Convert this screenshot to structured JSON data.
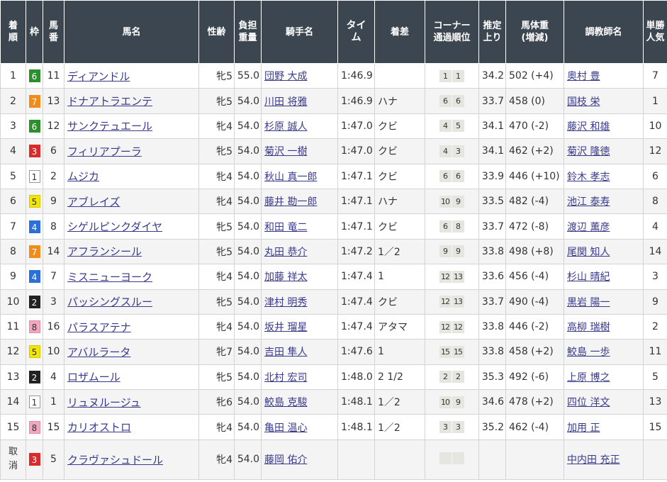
{
  "headers": {
    "rank": "着順",
    "waku": "枠",
    "umaban": "馬番",
    "horse": "馬名",
    "sexage": "性齢",
    "weight": "負担重量",
    "jockey": "騎手名",
    "time": "タイム",
    "margin": "着差",
    "corner": "コーナー通過順位",
    "last3f": "推定上り",
    "bodyweight": "馬体重(増減)",
    "trainer": "調教師名",
    "pop": "単勝人気"
  },
  "rows": [
    {
      "rank": "1",
      "waku": "6",
      "umaban": "11",
      "horse": "ディアンドル",
      "sexage": "牝5",
      "weight": "55.0",
      "jockey": "団野 大成",
      "time": "1:46.9",
      "margin": "",
      "corner": [
        "1",
        "1"
      ],
      "last3f": "34.2",
      "bodyweight": "502 (+4)",
      "trainer": "奥村 豊",
      "pop": "7"
    },
    {
      "rank": "2",
      "waku": "7",
      "umaban": "13",
      "horse": "ドナアトラエンテ",
      "sexage": "牝5",
      "weight": "54.0",
      "jockey": "川田 将雅",
      "time": "1:46.9",
      "margin": "ハナ",
      "corner": [
        "6",
        "6"
      ],
      "last3f": "33.7",
      "bodyweight": "458 (0)",
      "trainer": "国枝 栄",
      "pop": "1"
    },
    {
      "rank": "3",
      "waku": "6",
      "umaban": "12",
      "horse": "サンクテュエール",
      "sexage": "牝4",
      "weight": "54.0",
      "jockey": "杉原 誠人",
      "time": "1:47.0",
      "margin": "クビ",
      "corner": [
        "4",
        "5"
      ],
      "last3f": "34.1",
      "bodyweight": "470 (-2)",
      "trainer": "藤沢 和雄",
      "pop": "10"
    },
    {
      "rank": "4",
      "waku": "3",
      "umaban": "6",
      "horse": "フィリアプーラ",
      "sexage": "牝5",
      "weight": "54.0",
      "jockey": "菊沢 一樹",
      "time": "1:47.0",
      "margin": "クビ",
      "corner": [
        "4",
        "3"
      ],
      "last3f": "34.1",
      "bodyweight": "462 (+2)",
      "trainer": "菊沢 隆徳",
      "pop": "12"
    },
    {
      "rank": "5",
      "waku": "1",
      "umaban": "2",
      "horse": "ムジカ",
      "sexage": "牝4",
      "weight": "54.0",
      "jockey": "秋山 真一郎",
      "time": "1:47.1",
      "margin": "クビ",
      "corner": [
        "6",
        "6"
      ],
      "last3f": "33.9",
      "bodyweight": "446 (+10)",
      "trainer": "鈴木 孝志",
      "pop": "6"
    },
    {
      "rank": "6",
      "waku": "5",
      "umaban": "9",
      "horse": "アブレイズ",
      "sexage": "牝4",
      "weight": "54.0",
      "jockey": "藤井 勘一郎",
      "time": "1:47.1",
      "margin": "ハナ",
      "corner": [
        "10",
        "9"
      ],
      "last3f": "33.5",
      "bodyweight": "482 (-4)",
      "trainer": "池江 泰寿",
      "pop": "8"
    },
    {
      "rank": "7",
      "waku": "4",
      "umaban": "8",
      "horse": "シゲルピンクダイヤ",
      "sexage": "牝5",
      "weight": "54.0",
      "jockey": "和田 竜二",
      "time": "1:47.1",
      "margin": "クビ",
      "corner": [
        "6",
        "8"
      ],
      "last3f": "33.7",
      "bodyweight": "472 (-8)",
      "trainer": "渡辺 薫彦",
      "pop": "4"
    },
    {
      "rank": "8",
      "waku": "7",
      "umaban": "14",
      "horse": "アフランシール",
      "sexage": "牝5",
      "weight": "54.0",
      "jockey": "丸田 恭介",
      "time": "1:47.2",
      "margin": "1／2",
      "corner": [
        "9",
        "9"
      ],
      "last3f": "33.8",
      "bodyweight": "498 (+8)",
      "trainer": "尾関 知人",
      "pop": "14"
    },
    {
      "rank": "9",
      "waku": "4",
      "umaban": "7",
      "horse": "ミスニューヨーク",
      "sexage": "牝4",
      "weight": "54.0",
      "jockey": "加藤 祥太",
      "time": "1:47.4",
      "margin": "1",
      "corner": [
        "12",
        "13"
      ],
      "last3f": "33.6",
      "bodyweight": "456 (-4)",
      "trainer": "杉山 晴紀",
      "pop": "3"
    },
    {
      "rank": "10",
      "waku": "2",
      "umaban": "3",
      "horse": "パッシングスルー",
      "sexage": "牝5",
      "weight": "54.0",
      "jockey": "津村 明秀",
      "time": "1:47.4",
      "margin": "クビ",
      "corner": [
        "12",
        "13"
      ],
      "last3f": "33.7",
      "bodyweight": "490 (-4)",
      "trainer": "黒岩 陽一",
      "pop": "9"
    },
    {
      "rank": "11",
      "waku": "8",
      "umaban": "16",
      "horse": "パラスアテナ",
      "sexage": "牝4",
      "weight": "54.0",
      "jockey": "坂井 瑠星",
      "time": "1:47.4",
      "margin": "アタマ",
      "corner": [
        "12",
        "12"
      ],
      "last3f": "33.8",
      "bodyweight": "446 (-2)",
      "trainer": "高柳 瑞樹",
      "pop": "2"
    },
    {
      "rank": "12",
      "waku": "5",
      "umaban": "10",
      "horse": "アバルラータ",
      "sexage": "牝7",
      "weight": "54.0",
      "jockey": "吉田 隼人",
      "time": "1:47.6",
      "margin": "1",
      "corner": [
        "15",
        "15"
      ],
      "last3f": "33.8",
      "bodyweight": "458 (+2)",
      "trainer": "鮫島 一歩",
      "pop": "11"
    },
    {
      "rank": "13",
      "waku": "2",
      "umaban": "4",
      "horse": "ロザムール",
      "sexage": "牝5",
      "weight": "54.0",
      "jockey": "北村 宏司",
      "time": "1:48.0",
      "margin": "2 1/2",
      "corner": [
        "2",
        "2"
      ],
      "last3f": "35.3",
      "bodyweight": "492 (-6)",
      "trainer": "上原 博之",
      "pop": "5"
    },
    {
      "rank": "14",
      "waku": "1",
      "umaban": "1",
      "horse": "リュヌルージュ",
      "sexage": "牝6",
      "weight": "54.0",
      "jockey": "鮫島 克駿",
      "time": "1:48.1",
      "margin": "1／2",
      "corner": [
        "10",
        "9"
      ],
      "last3f": "34.6",
      "bodyweight": "478 (+2)",
      "trainer": "四位 洋文",
      "pop": "13"
    },
    {
      "rank": "15",
      "waku": "8",
      "umaban": "15",
      "horse": "カリオストロ",
      "sexage": "牝4",
      "weight": "54.0",
      "jockey": "亀田 温心",
      "time": "1:48.1",
      "margin": "1／2",
      "corner": [
        "3",
        "3"
      ],
      "last3f": "35.2",
      "bodyweight": "462 (-4)",
      "trainer": "加用 正",
      "pop": "15"
    },
    {
      "rank": "取消",
      "waku": "3",
      "umaban": "5",
      "horse": "クラヴァシュドール",
      "sexage": "牝4",
      "weight": "54.0",
      "jockey": "藤岡 佑介",
      "time": "",
      "margin": "",
      "corner": [
        "",
        ""
      ],
      "last3f": "",
      "bodyweight": "",
      "trainer": "中内田 充正",
      "pop": ""
    }
  ]
}
